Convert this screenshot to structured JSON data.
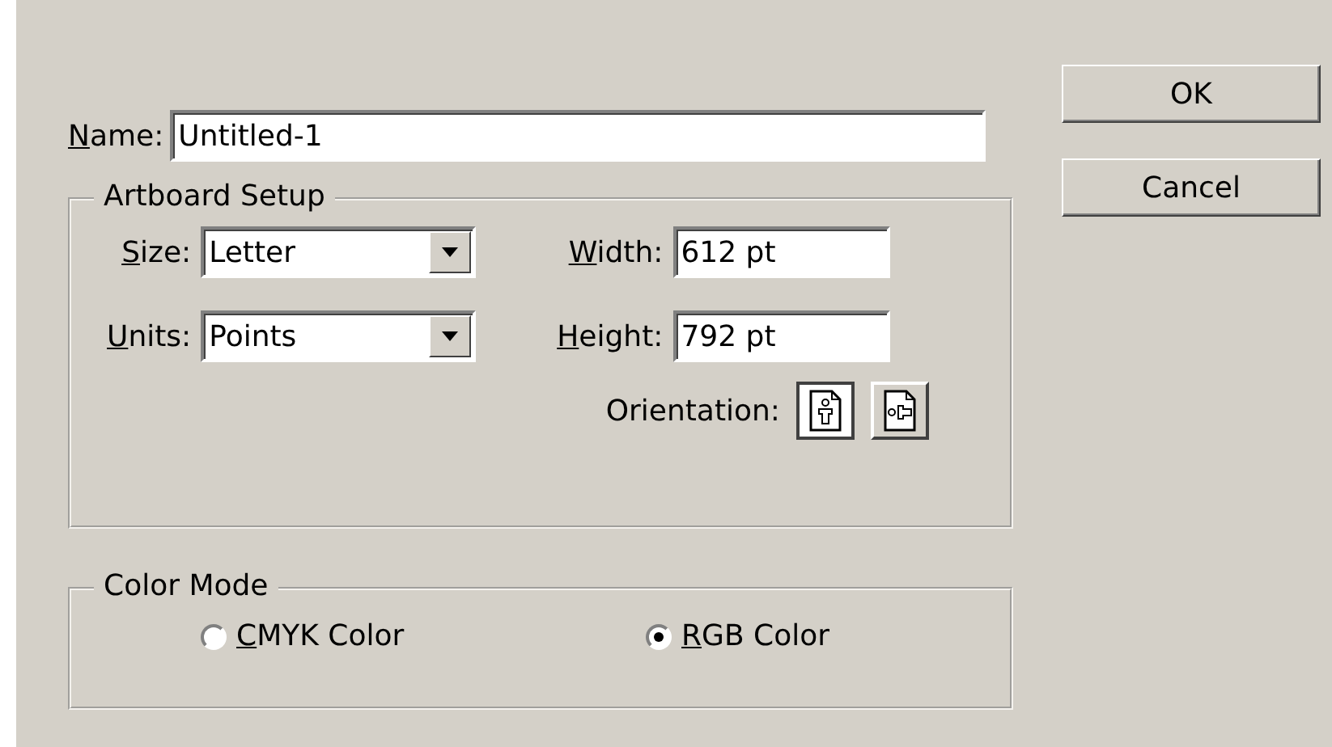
{
  "name_field": {
    "label": "Name:",
    "underline_first": true,
    "value": "Untitled-1"
  },
  "artboard_setup": {
    "title": "Artboard Setup",
    "dropdowns": [
      {
        "label": "Size:",
        "underline_first": true,
        "value": "Letter"
      },
      {
        "label": "Units:",
        "underline_first": true,
        "value": "Points"
      }
    ],
    "fields": [
      {
        "label": "Width:",
        "underline_first": true,
        "value": "612 pt"
      },
      {
        "label": "Height:",
        "underline_first": true,
        "value": "792 pt"
      }
    ],
    "orientation": {
      "label": "Orientation:",
      "options": [
        {
          "kind": "portrait",
          "selected": true
        },
        {
          "kind": "landscape",
          "selected": false
        }
      ]
    }
  },
  "color_mode": {
    "title": "Color Mode",
    "options": [
      {
        "label": "CMYK Color",
        "underline_first": true,
        "selected": false
      },
      {
        "label": "RGB Color",
        "underline_first": true,
        "selected": true
      }
    ]
  },
  "buttons": [
    "OK",
    "Cancel"
  ]
}
